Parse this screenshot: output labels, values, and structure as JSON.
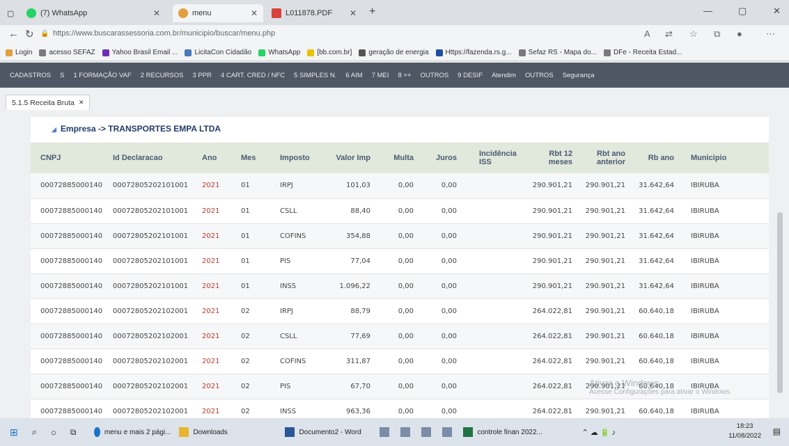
{
  "browser": {
    "tabs": [
      {
        "label": "(7) WhatsApp",
        "close": "✕",
        "color": "#25d366"
      },
      {
        "label": "menu",
        "close": "✕",
        "color": "#e2a03f"
      },
      {
        "label": "L011878.PDF",
        "close": "✕",
        "color": "#d9423a"
      }
    ],
    "new_tab": "+",
    "window_controls": [
      "—",
      "▢",
      "✕"
    ],
    "nav": {
      "back": "←",
      "reload": "↻",
      "lock": "🔒"
    },
    "url": "https://www.buscarassessoria.com.br/municipio/buscar/menu.php",
    "bookmarks": [
      {
        "label": "Login",
        "color": "#e2a03f"
      },
      {
        "label": "acesso SEFAZ",
        "color": "#7a7a7a"
      },
      {
        "label": "Yahoo Brasil Email ...",
        "color": "#6b2fb5"
      },
      {
        "label": "LicitaCon Cidadão",
        "color": "#4a78b8"
      },
      {
        "label": "WhatsApp",
        "color": "#25d366"
      },
      {
        "label": "[bb.com.br]",
        "color": "#e8c400"
      },
      {
        "label": "geração de energia",
        "color": "#555555"
      },
      {
        "label": "Https://fazenda.rs.g...",
        "color": "#1f4fa3"
      },
      {
        "label": "Sefaz RS - Mapa do...",
        "color": "#7a7a7a"
      },
      {
        "label": "DFe - Receita Estad...",
        "color": "#7a7a7a"
      }
    ]
  },
  "app_menu": [
    "CADASTROS",
    "S",
    "1 FORMAÇÃO VAF",
    "2 RECURSOS",
    "3 PPR",
    "4 CART. CRED / NFC",
    "5 SIMPLES N.",
    "6 AIM",
    "7 MEI",
    "8 ++",
    "OUTROS",
    "9 DESIF",
    "Atendim",
    "OUTROS",
    "Segurança"
  ],
  "page_tab": {
    "label": "5.1.5 Receita Bruta",
    "close": "✕"
  },
  "company": "Empresa -> TRANSPORTES EMPA LTDA",
  "table": {
    "headers": [
      "CNPJ",
      "Id Declaracao",
      "Ano",
      "Mes",
      "Imposto",
      "Valor Imp",
      "Multa",
      "Juros",
      "Incidência ISS",
      "Rbt 12 meses",
      "Rbt ano anterior",
      "Rb ano",
      "Municipio"
    ],
    "rows": [
      [
        "00072885000140",
        "00072805202101001",
        "2021",
        "01",
        "IRPJ",
        "101,03",
        "0,00",
        "0,00",
        "",
        "290.901,21",
        "290.901,21",
        "31.642,64",
        "IBIRUBA"
      ],
      [
        "00072885000140",
        "00072805202101001",
        "2021",
        "01",
        "CSLL",
        "88,40",
        "0,00",
        "0,00",
        "",
        "290.901,21",
        "290.901,21",
        "31.642,64",
        "IBIRUBA"
      ],
      [
        "00072885000140",
        "00072805202101001",
        "2021",
        "01",
        "COFINS",
        "354,88",
        "0,00",
        "0,00",
        "",
        "290.901,21",
        "290.901,21",
        "31.642,64",
        "IBIRUBA"
      ],
      [
        "00072885000140",
        "00072805202101001",
        "2021",
        "01",
        "PIS",
        "77,04",
        "0,00",
        "0,00",
        "",
        "290.901,21",
        "290.901,21",
        "31.642,64",
        "IBIRUBA"
      ],
      [
        "00072885000140",
        "00072805202101001",
        "2021",
        "01",
        "INSS",
        "1.096,22",
        "0,00",
        "0,00",
        "",
        "290.901,21",
        "290.901,21",
        "31.642,64",
        "IBIRUBA"
      ],
      [
        "00072885000140",
        "00072805202102001",
        "2021",
        "02",
        "IRPJ",
        "88,79",
        "0,00",
        "0,00",
        "",
        "264.022,81",
        "290.901,21",
        "60.640,18",
        "IBIRUBA"
      ],
      [
        "00072885000140",
        "00072805202102001",
        "2021",
        "02",
        "CSLL",
        "77,69",
        "0,00",
        "0,00",
        "",
        "264.022,81",
        "290.901,21",
        "60.640,18",
        "IBIRUBA"
      ],
      [
        "00072885000140",
        "00072805202102001",
        "2021",
        "02",
        "COFINS",
        "311,87",
        "0,00",
        "0,00",
        "",
        "264.022,81",
        "290.901,21",
        "60.640,18",
        "IBIRUBA"
      ],
      [
        "00072885000140",
        "00072805202102001",
        "2021",
        "02",
        "PIS",
        "67,70",
        "0,00",
        "0,00",
        "",
        "264.022,81",
        "290.901,21",
        "60.640,18",
        "IBIRUBA"
      ],
      [
        "00072885000140",
        "00072805202102001",
        "2021",
        "02",
        "INSS",
        "963,36",
        "0,00",
        "0,00",
        "",
        "264.022,81",
        "290.901,21",
        "60.640,18",
        "IBIRUBA"
      ]
    ]
  },
  "watermark": {
    "line1": "Ativar o Windows",
    "line2": "Acesse Configurações para ativar o Windows."
  },
  "taskbar": {
    "items": [
      {
        "label": "menu e mais 2 pági...",
        "color": "#1a73c8"
      },
      {
        "label": "Downloads",
        "color": "#e8b530"
      },
      {
        "label": "Documento2 - Word",
        "color": "#2b579a"
      },
      {
        "label": "controle finan 2022...",
        "color": "#217346"
      }
    ],
    "time": "18:23",
    "date": "11/08/2022"
  }
}
